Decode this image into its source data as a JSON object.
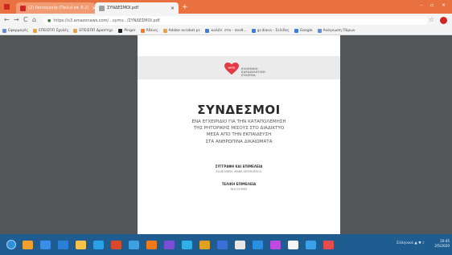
{
  "browser": {
    "tabs": [
      {
        "label": "(2) Λειτουργία (Παλιό υπ. 6.2)",
        "active": false,
        "favicon_color": "#d02323"
      },
      {
        "label": "ΣΥΝΔΕΣΜΟΙ.pdf",
        "active": true,
        "favicon_color": "#9e9e9e"
      }
    ],
    "new_tab_label": "+",
    "window_controls": "– ▫ ×",
    "back_label": "←",
    "forward_label": "→",
    "reload_label": "C",
    "home_label": "⌂",
    "url": "https://s3.amazonaws.com/...symv.../ΣΥΝΔΕΣΜΟΙ.pdf",
    "bookmark_star": "☆",
    "bookmarks": [
      {
        "label": "Εφαρμογές",
        "color": "#5f8fd6"
      },
      {
        "label": "ΕΠΕΙΣΠΠ Σχολές",
        "color": "#e8a33d"
      },
      {
        "label": "ΕΠΕΙΣΠΠ Δραστηρ.",
        "color": "#e8a33d"
      },
      {
        "label": "Pinger",
        "color": "#222222"
      },
      {
        "label": "Άδειες",
        "color": "#ff7a1a"
      },
      {
        "label": "Adobe acrobat pr.",
        "color": "#e8a33d"
      },
      {
        "label": "καλέσ. στο - συνθ...",
        "color": "#3c7de0"
      },
      {
        "label": "gr.diana - Σελίδες",
        "color": "#3c7de0"
      },
      {
        "label": "Google",
        "color": "#3c7de0"
      },
      {
        "label": "Ανάγνωση Πόρων",
        "color": "#5f8fd6"
      }
    ]
  },
  "document": {
    "logo_text": "ΕΛΛΗΝΙΚΗ ΚΑΡΔΙΟΛΟΓΙΚΗ ΕΤΑΙΡΕΙΑ",
    "title": "ΣΥΝΔΕΣΜΟΙ",
    "subtitle_lines": [
      "ΕΝΑ ΕΓΧΕΙΡΙΔΙΟ ΓΙΑ ΤΗΝ ΚΑΤΑΠΟΛΕΜΗΣΗ",
      "ΤΗΣ ΡΗΤΟΡΙΚΗΣ ΜΙΣΟΥΣ ΣΤΟ ΔΙΑΔΙΚΤΥΟ",
      "ΜΕΣΑ ΑΠΟ ΤΗΝ ΕΚΠΑΙΔΕΥΣΗ",
      "ΣΤΑ ΑΝΘΡΩΠΙΝΑ ΔΙΚΑΙΩΜΑΤΑ"
    ],
    "authors_heading": "ΣΥΓΓΡΑΦΗ ΚΑΙ ΕΠΙΜΕΛΕΙΑ",
    "authors_text": "ELLIE KEEN, MARA GEORGESCU",
    "final_heading": "ΤΕΛΙΚΗ ΕΠΙΜΕΛΕΙΑ",
    "final_text": "RUI GOMES",
    "brand_color": "#e63946"
  },
  "taskbar": {
    "tray_text": "Ελληνικά ▲ ▼ ♪",
    "time": "10:45",
    "date": "2/5/2020",
    "icons": [
      "#f0a030",
      "#3a8ee6",
      "#2b7fd6",
      "#f6c24a",
      "#2aa0e6",
      "#d84a2b",
      "#3fa0e0",
      "#f07a1a",
      "#7a4fd6",
      "#2fb0e8",
      "#e0a020",
      "#3a6fd6",
      "#e8e8e8",
      "#2b8fe0",
      "#c04ae0",
      "#f4f4f4",
      "#3aa0e8",
      "#e64a4a"
    ]
  }
}
